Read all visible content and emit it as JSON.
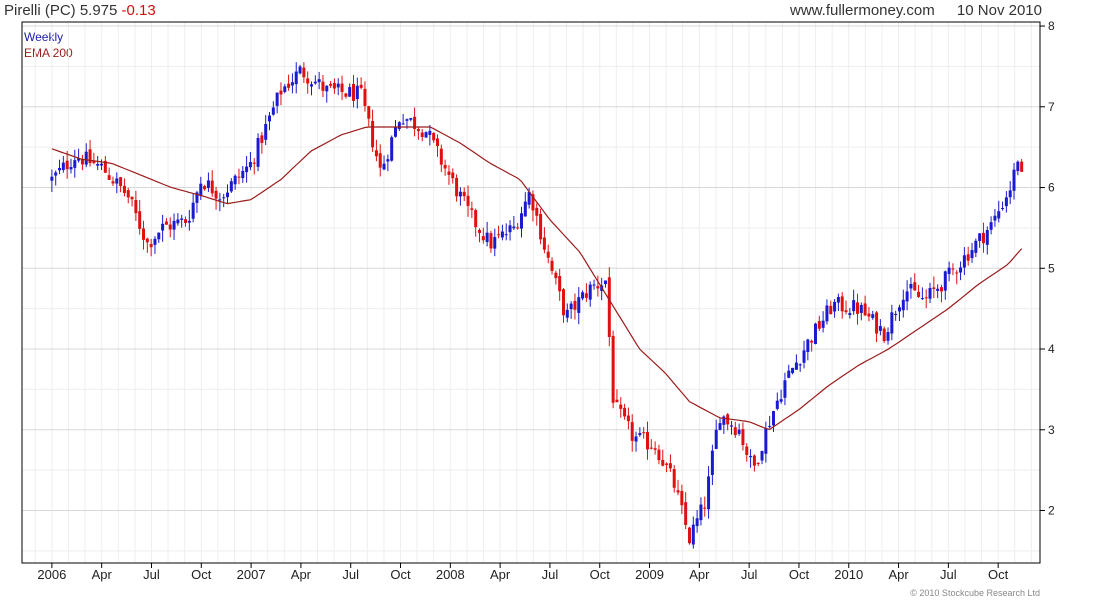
{
  "header": {
    "title": "Pirelli (PC) 5.975",
    "change": "-0.13",
    "site": "www.fullermoney.com",
    "date": "10 Nov 2010"
  },
  "legend": {
    "weekly": "Weekly",
    "ema": "EMA 200"
  },
  "copyright": "© 2010 Stockcube Research Ltd",
  "colors": {
    "up": "#1a1ad0",
    "down": "#e01010",
    "ema": "#9b1b1b",
    "grid": "#d8d8d8",
    "axis": "#000000"
  },
  "chart_data": {
    "type": "candlestick",
    "title": "Pirelli (PC) 5.975 -0.13",
    "x_tick_labels": [
      "2006",
      "Apr",
      "Jul",
      "Oct",
      "2007",
      "Apr",
      "Jul",
      "Oct",
      "2008",
      "Apr",
      "Jul",
      "Oct",
      "2009",
      "Apr",
      "Jul",
      "Oct",
      "2010",
      "Apr",
      "Jul",
      "Oct"
    ],
    "y_ticks": [
      2,
      3,
      4,
      5,
      6,
      7,
      8
    ],
    "ylim": [
      1.35,
      8.05
    ],
    "grid": true,
    "series": [
      {
        "name": "Weekly",
        "style": "candles",
        "color_up": "#1a1ad0",
        "color_down": "#e01010",
        "anchors": [
          {
            "t": 2006.0,
            "v": 6.1
          },
          {
            "t": 2006.12,
            "v": 6.4
          },
          {
            "t": 2006.25,
            "v": 6.25
          },
          {
            "t": 2006.38,
            "v": 5.9
          },
          {
            "t": 2006.48,
            "v": 5.3
          },
          {
            "t": 2006.55,
            "v": 5.5
          },
          {
            "t": 2006.68,
            "v": 5.6
          },
          {
            "t": 2006.75,
            "v": 6.1
          },
          {
            "t": 2006.85,
            "v": 5.9
          },
          {
            "t": 2007.0,
            "v": 6.3
          },
          {
            "t": 2007.15,
            "v": 7.2
          },
          {
            "t": 2007.25,
            "v": 7.45
          },
          {
            "t": 2007.38,
            "v": 7.2
          },
          {
            "t": 2007.55,
            "v": 7.15
          },
          {
            "t": 2007.65,
            "v": 6.2
          },
          {
            "t": 2007.75,
            "v": 6.9
          },
          {
            "t": 2007.88,
            "v": 6.7
          },
          {
            "t": 2007.95,
            "v": 6.35
          },
          {
            "t": 2008.1,
            "v": 5.65
          },
          {
            "t": 2008.2,
            "v": 5.3
          },
          {
            "t": 2008.32,
            "v": 5.5
          },
          {
            "t": 2008.4,
            "v": 5.95
          },
          {
            "t": 2008.48,
            "v": 5.2
          },
          {
            "t": 2008.58,
            "v": 4.4
          },
          {
            "t": 2008.7,
            "v": 4.75
          },
          {
            "t": 2008.78,
            "v": 4.85
          },
          {
            "t": 2008.82,
            "v": 3.3
          },
          {
            "t": 2008.92,
            "v": 2.9
          },
          {
            "t": 2009.03,
            "v": 2.8
          },
          {
            "t": 2009.12,
            "v": 2.35
          },
          {
            "t": 2009.2,
            "v": 1.65
          },
          {
            "t": 2009.28,
            "v": 2.1
          },
          {
            "t": 2009.35,
            "v": 3.2
          },
          {
            "t": 2009.45,
            "v": 3.0
          },
          {
            "t": 2009.52,
            "v": 2.5
          },
          {
            "t": 2009.6,
            "v": 3.1
          },
          {
            "t": 2009.68,
            "v": 3.6
          },
          {
            "t": 2009.8,
            "v": 4.1
          },
          {
            "t": 2009.92,
            "v": 4.55
          },
          {
            "t": 2010.05,
            "v": 4.5
          },
          {
            "t": 2010.18,
            "v": 4.2
          },
          {
            "t": 2010.28,
            "v": 4.75
          },
          {
            "t": 2010.38,
            "v": 4.6
          },
          {
            "t": 2010.5,
            "v": 4.9
          },
          {
            "t": 2010.62,
            "v": 5.25
          },
          {
            "t": 2010.72,
            "v": 5.55
          },
          {
            "t": 2010.82,
            "v": 6.05
          },
          {
            "t": 2010.86,
            "v": 6.5
          },
          {
            "t": 2010.87,
            "v": 6.0
          }
        ]
      },
      {
        "name": "EMA 200",
        "style": "line",
        "color": "#9b1b1b",
        "points": [
          {
            "t": 2006.0,
            "v": 6.48
          },
          {
            "t": 2006.15,
            "v": 6.35
          },
          {
            "t": 2006.3,
            "v": 6.3
          },
          {
            "t": 2006.45,
            "v": 6.15
          },
          {
            "t": 2006.6,
            "v": 6.0
          },
          {
            "t": 2006.75,
            "v": 5.9
          },
          {
            "t": 2006.88,
            "v": 5.8
          },
          {
            "t": 2007.0,
            "v": 5.85
          },
          {
            "t": 2007.15,
            "v": 6.1
          },
          {
            "t": 2007.3,
            "v": 6.45
          },
          {
            "t": 2007.45,
            "v": 6.65
          },
          {
            "t": 2007.58,
            "v": 6.75
          },
          {
            "t": 2007.75,
            "v": 6.75
          },
          {
            "t": 2007.9,
            "v": 6.75
          },
          {
            "t": 2008.05,
            "v": 6.55
          },
          {
            "t": 2008.2,
            "v": 6.3
          },
          {
            "t": 2008.35,
            "v": 6.1
          },
          {
            "t": 2008.5,
            "v": 5.6
          },
          {
            "t": 2008.65,
            "v": 5.2
          },
          {
            "t": 2008.8,
            "v": 4.6
          },
          {
            "t": 2008.95,
            "v": 4.0
          },
          {
            "t": 2009.08,
            "v": 3.7
          },
          {
            "t": 2009.2,
            "v": 3.35
          },
          {
            "t": 2009.35,
            "v": 3.15
          },
          {
            "t": 2009.5,
            "v": 3.1
          },
          {
            "t": 2009.6,
            "v": 3.0
          },
          {
            "t": 2009.75,
            "v": 3.25
          },
          {
            "t": 2009.9,
            "v": 3.55
          },
          {
            "t": 2010.05,
            "v": 3.8
          },
          {
            "t": 2010.2,
            "v": 4.0
          },
          {
            "t": 2010.35,
            "v": 4.25
          },
          {
            "t": 2010.5,
            "v": 4.5
          },
          {
            "t": 2010.65,
            "v": 4.8
          },
          {
            "t": 2010.8,
            "v": 5.05
          },
          {
            "t": 2010.87,
            "v": 5.25
          }
        ]
      }
    ]
  }
}
